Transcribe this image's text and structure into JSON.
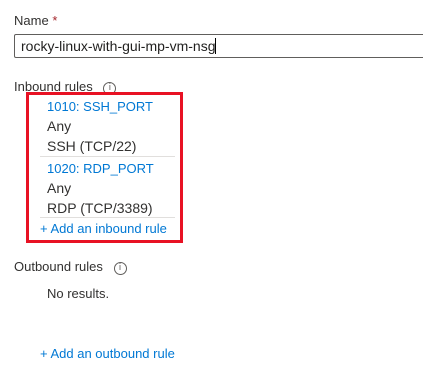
{
  "name_field": {
    "label": "Name",
    "required_marker": "*",
    "value": "rocky-linux-with-gui-mp-vm-nsg"
  },
  "inbound": {
    "label": "Inbound rules",
    "info_glyph": "i",
    "rules": [
      {
        "name": "1010: SSH_PORT",
        "source": "Any",
        "service": "SSH (TCP/22)"
      },
      {
        "name": "1020: RDP_PORT",
        "source": "Any",
        "service": "RDP (TCP/3389)"
      }
    ],
    "add_link": "+ Add an inbound rule"
  },
  "outbound": {
    "label": "Outbound rules",
    "info_glyph": "i",
    "empty_text": "No results.",
    "add_link": "+ Add an outbound rule"
  },
  "colors": {
    "link": "#0078d4",
    "highlight": "#e81123",
    "required": "#a4262c"
  }
}
